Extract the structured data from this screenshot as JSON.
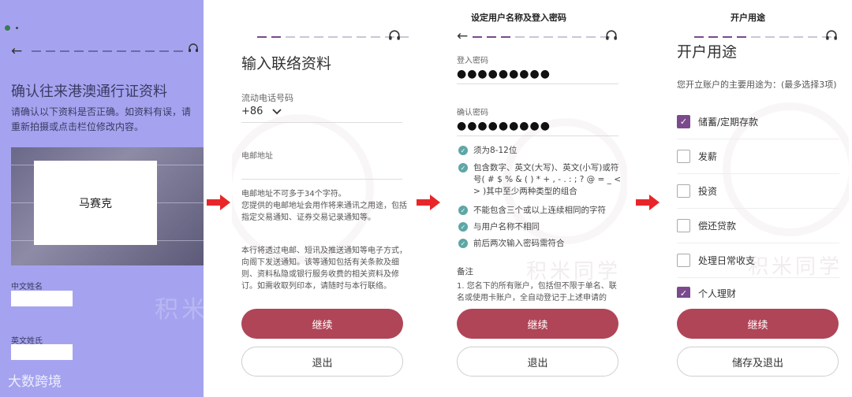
{
  "panel1": {
    "title": "确认往来港澳通行证资料",
    "description": "请确认以下资料是否正确。如资料有误，请重新拍摄或点击栏位修改内容。",
    "photo_name": "马赛克",
    "chinese_name_label": "中文姓名",
    "english_surname_label": "英文姓氏",
    "watermark": "积米同学",
    "brand": "大数跨境"
  },
  "panel2": {
    "heading": "输入联络资料",
    "phone_label": "流动电话号码",
    "country_code": "+86",
    "email_label": "电邮地址",
    "email_note": "电邮地址不可多于34个字符。\n您提供的电邮地址会用作将来通讯之用途，包括指定交易通知、证券交易记录通知等。",
    "notice": "本行将透过电邮、短讯及推送通知等电子方式，向阁下发送通知。该等通知包括有关条款及细则、资料私隐或银行服务收费的相关资料及修订。如需收取列印本，请随时与本行联络。",
    "continue_button": "继续",
    "exit_button": "退出"
  },
  "panel3": {
    "header": "设定用户名称及登入密码",
    "login_password_label": "登入密码",
    "login_password_value": "●●●●●●●●●",
    "confirm_password_label": "确认密码",
    "confirm_password_value": "●●●●●●●●●",
    "rules": [
      "须为8-12位",
      "包含数字、英文(大写)、英文(小写)或符号( # $ % & ( ) * + , - . : ; ? @ = _ < > )其中至少两种类型的组合",
      "不能包含三个或以上连续相同的字符",
      "与用户名称不相同",
      "前后两次输入密码需符合"
    ],
    "remarks_label": "备注",
    "remarks_text": "1.  您名下的所有账户，包括但不限于单名、联名或使用卡账户，全自动登记于上述申请的",
    "continue_button": "继续",
    "exit_button": "退出",
    "watermark": "积米同学"
  },
  "panel4": {
    "header": "开户用途",
    "heading": "开户用途",
    "question": "您开立账户的主要用途为：(最多选择3项)",
    "options": [
      {
        "label": "储蓄/定期存款",
        "checked": "yes"
      },
      {
        "label": "发薪",
        "checked": "no"
      },
      {
        "label": "投资",
        "checked": "no"
      },
      {
        "label": "偿还贷款",
        "checked": "no"
      },
      {
        "label": "处理日常收支",
        "checked": "no"
      },
      {
        "label": "个人理财",
        "checked": "yes"
      }
    ],
    "continue_button": "继续",
    "save_exit_button": "储存及退出",
    "watermark": "积米同学"
  },
  "colors": {
    "primary_button": "#b04558",
    "progress_active": "#7a4a8c",
    "check_teal": "#5ea7a6",
    "arrow_red": "#e8262a",
    "panel1_background": "#a5a3ef"
  },
  "icons": [
    "back-arrow-icon",
    "headset-icon",
    "chevron-down-icon",
    "check-circle-icon",
    "right-arrow-icon"
  ]
}
